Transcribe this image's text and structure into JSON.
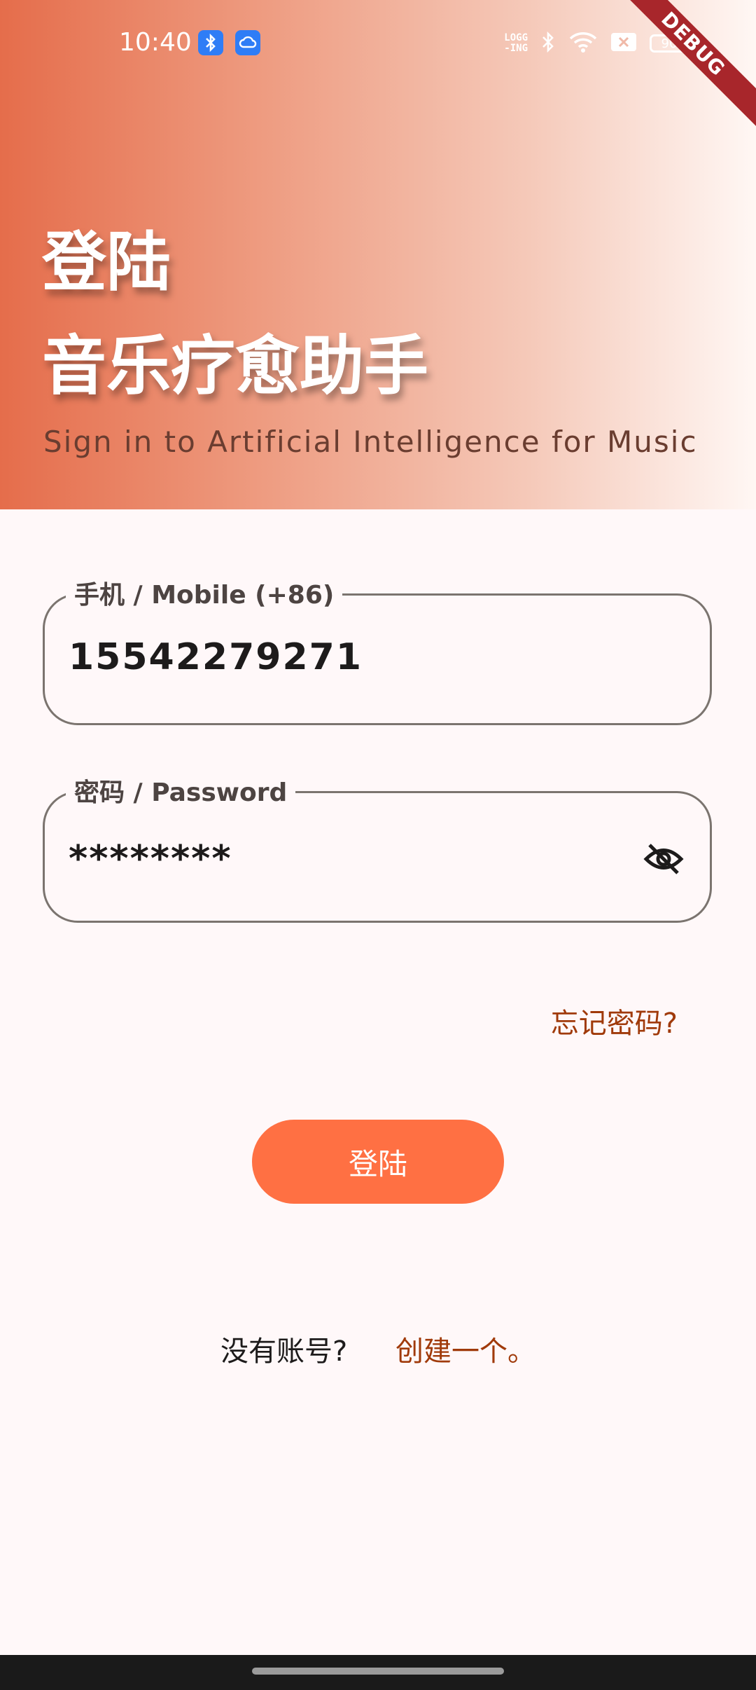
{
  "status_bar": {
    "time": "10:40",
    "logging_label_top": "LOGG",
    "logging_label_bottom": "-ING",
    "battery": "90"
  },
  "debug_banner": "DEBUG",
  "header": {
    "title_line1": "登陆",
    "title_line2": "音乐疗愈助手",
    "subtitle": "Sign in to Artificial Intelligence for Music"
  },
  "form": {
    "mobile_label": "手机 / Mobile (+86)",
    "mobile_value": "15542279271",
    "password_label": "密码 / Password",
    "password_value": "********",
    "forgot_password": "忘记密码?",
    "login_button": "登陆"
  },
  "signup": {
    "prompt": "没有账号?",
    "link": "创建一个。"
  },
  "colors": {
    "accent": "#ff7043",
    "link": "#a03a0a",
    "background": "#fff8f9"
  }
}
